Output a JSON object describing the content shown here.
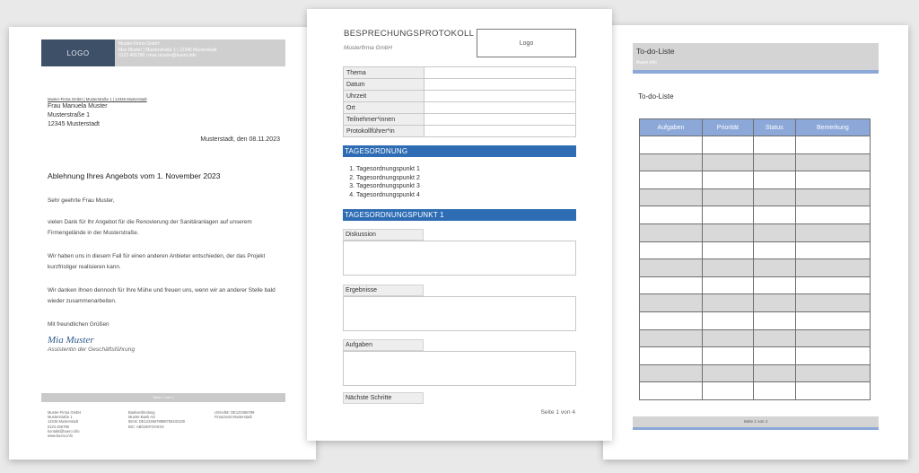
{
  "letter": {
    "logo": "LOGO",
    "company_header": [
      "Muster-Firma GmbH",
      "Max Muster | Musterstraße 1 | 12345 Musterstadt",
      "0123 456789 | max.muster@buero.info"
    ],
    "sender_line": "Muster-Firma GmbH | Musterstraße 1 | 12345 Musterstadt",
    "recipient": [
      "Frau Manuela Muster",
      "Musterstraße 1",
      "12345 Musterstadt"
    ],
    "date": "Musterstadt, den 08.11.2023",
    "subject": "Ablehnung Ihres Angebots vom 1. November 2023",
    "salutation": "Sehr geehrte Frau Muster,",
    "para1": "vielen Dank für Ihr Angebot für die Renovierung der Sanitäranlagen auf unserem Firmengelände in der Musterstraße.",
    "para2": "Wir haben uns in diesem Fall für einen anderen Anbieter entschieden, der das Projekt kurzfristiger realisieren kann.",
    "para3": "Wir danken Ihnen dennoch für Ihre Mühe und freuen uns, wenn wir an anderer Stelle bald wieder zusammenarbeiten.",
    "closing": "Mit freundlichen Grüßen",
    "signature": "Mia Muster",
    "role": "Assistentin der Geschäftsführung",
    "page_footer": "Seite 1 von 1",
    "footer_col1": [
      "Muster-Firma GmbH",
      "Musterstraße 1",
      "12345 Musterstadt",
      "0123 456789",
      "kontakt@buero.info",
      "www.buero.info"
    ],
    "footer_col2": [
      "Bankverbindung",
      "Muster-Bank AG",
      "IBAN: DE12345678998765432100",
      "BIC: ABCDEFGHXXX"
    ],
    "footer_col3": [
      "USt-IdNr: DE123456789",
      "Finanzamt Musterstadt"
    ]
  },
  "protocol": {
    "title": "BESPRECHUNGSPROTOKOLL",
    "subtitle": "Musterfirma GmbH",
    "logo": "Logo",
    "rows": [
      "Thema",
      "Datum",
      "Uhrzeit",
      "Ort",
      "Teilnehmer*innen",
      "Protokollführer*in"
    ],
    "section1": "TAGESORDNUNG",
    "agenda": [
      "Tagesordnungspunkt 1",
      "Tagesordnungspunkt 2",
      "Tagesordnungspunkt 3",
      "Tagesordnungspunkt 4"
    ],
    "section2": "TAGESORDNUNGSPUNKT 1",
    "label_discussion": "Diskussion",
    "label_results": "Ergebnisse",
    "label_tasks": "Aufgaben",
    "label_next": "Nächste Schritte",
    "page": "Seite 1 von 4"
  },
  "todo": {
    "header_title": "To-do-Liste",
    "header_sub": "Buero.info",
    "title": "To-do-Liste",
    "columns": [
      "Aufgaben",
      "Priorität",
      "Status",
      "Bemerkung"
    ],
    "page": "Seite 1 von 1"
  },
  "colors": {
    "accent_blue": "#2e6db4",
    "table_blue": "#8ca8d9",
    "logo_navy": "#3e5068",
    "signature": "#2d5a8c"
  }
}
